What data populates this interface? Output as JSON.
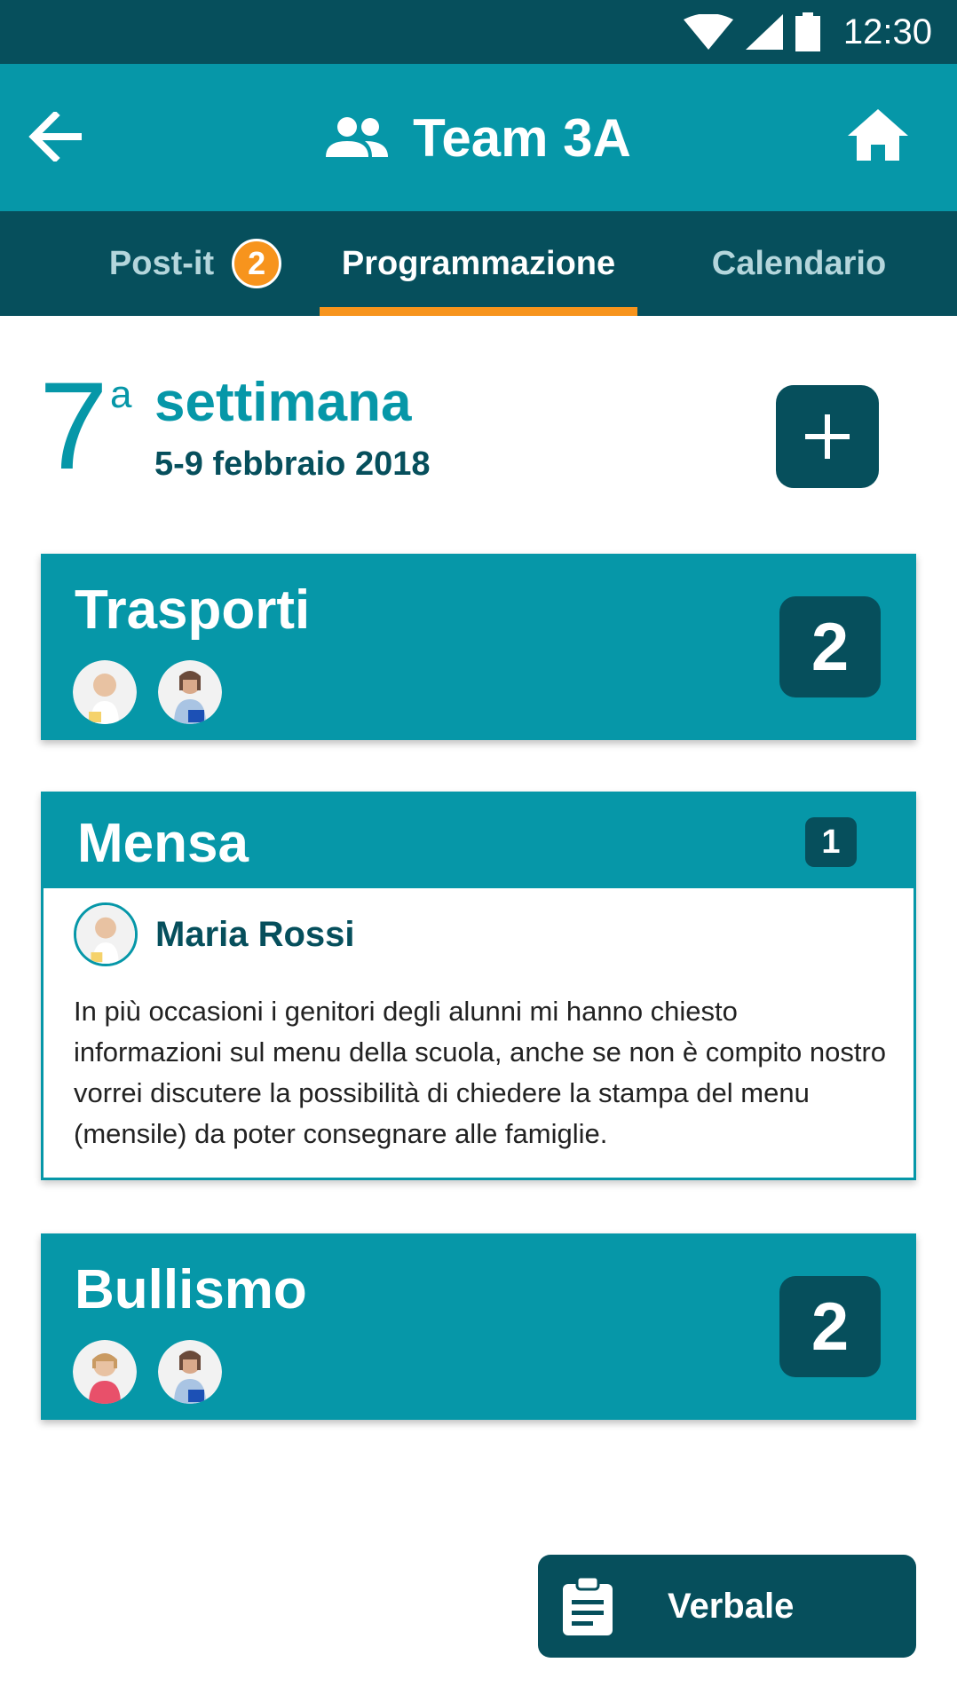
{
  "status_bar": {
    "time": "12:30",
    "icons": [
      "wifi-icon",
      "signal-icon",
      "battery-icon"
    ]
  },
  "app_bar": {
    "title": "Team 3A",
    "title_icon": "group-icon",
    "back_icon": "arrow-left-icon",
    "home_icon": "home-icon"
  },
  "tabs": [
    {
      "label": "Post-it",
      "badge": "2"
    },
    {
      "label": "Programmazione",
      "active": true
    },
    {
      "label": "Calendario"
    }
  ],
  "week": {
    "number": "7",
    "superscript": "a",
    "label": "settimana",
    "dates": "5-9 febbraio 2018"
  },
  "cards": [
    {
      "title": "Trasporti",
      "count": "2"
    },
    {
      "title": "Mensa",
      "count": "1",
      "author": "Maria Rossi",
      "text": "In più occasioni i genitori degli alunni mi hanno chiesto informazioni sul menu della scuola, anche se non è compito nostro vorrei discutere la possibilità di chiedere la stampa del menu (mensile) da poter consegnare alle famiglie."
    },
    {
      "title": "Bullismo",
      "count": "2"
    }
  ],
  "footer": {
    "verbale_label": "Verbale",
    "verbale_icon": "clipboard-icon"
  },
  "colors": {
    "primary": "#0697a8",
    "dark": "#064f5c",
    "accent": "#f7941d"
  }
}
